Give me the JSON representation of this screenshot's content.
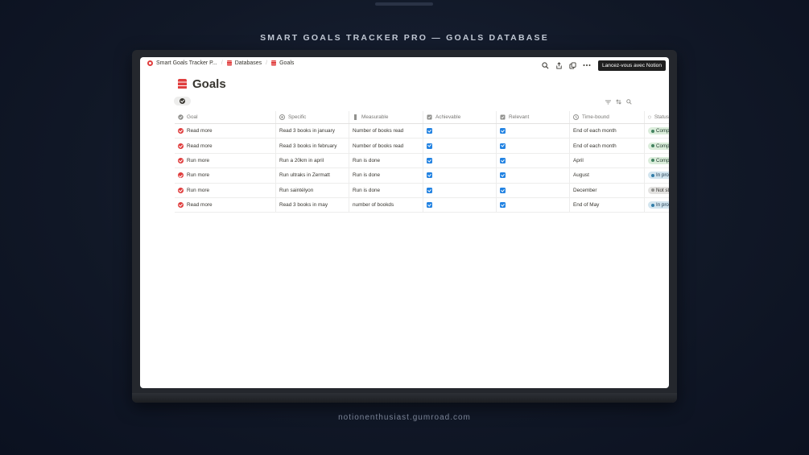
{
  "page_heading": "SMART GOALS TRACKER PRO — GOALS DATABASE",
  "footer_url": "notionenthusiast.gumroad.com",
  "breadcrumbs": [
    "Smart Goals Tracker P...",
    "Databases",
    "Goals"
  ],
  "topbar": {
    "icons": [
      "search-icon",
      "share-icon",
      "duplicate-icon",
      "more-icon"
    ],
    "cta_label": "Lancez-vous avec Notion"
  },
  "database": {
    "title": "Goals",
    "view_tools": [
      "filter-icon",
      "sort-icon",
      "search-icon"
    ]
  },
  "table": {
    "columns": [
      "Goal",
      "Specific",
      "Measurable",
      "Achievable",
      "Relevant",
      "Time-bound",
      "Status"
    ],
    "rows": [
      {
        "goal": "Read more",
        "specific": "Read 3 books in january",
        "measurable": "Number of books read",
        "achievable": true,
        "relevant": true,
        "time_bound": "End of each month",
        "status": "Comp",
        "status_type": "done"
      },
      {
        "goal": "Read more",
        "specific": "Read 3 books in february",
        "measurable": "Number of books read",
        "achievable": true,
        "relevant": true,
        "time_bound": "End of each month",
        "status": "Comp",
        "status_type": "done"
      },
      {
        "goal": "Run more",
        "specific": "Run a 20km in april",
        "measurable": "Run is done",
        "achievable": true,
        "relevant": true,
        "time_bound": "April",
        "status": "Comp",
        "status_type": "done"
      },
      {
        "goal": "Run more",
        "specific": "Run ultraks in Zermatt",
        "measurable": "Run is done",
        "achievable": true,
        "relevant": true,
        "time_bound": "August",
        "status": "In prog",
        "status_type": "progress"
      },
      {
        "goal": "Run more",
        "specific": "Run saintélyon",
        "measurable": "Run is done",
        "achievable": true,
        "relevant": true,
        "time_bound": "December",
        "status": "Not st",
        "status_type": "not-started"
      },
      {
        "goal": "Read more",
        "specific": "Read 3 books in may",
        "measurable": "number of bookds",
        "achievable": true,
        "relevant": true,
        "time_bound": "End of May",
        "status": "In prog",
        "status_type": "progress"
      }
    ]
  },
  "colors": {
    "accent_blue": "#2383e2",
    "icon_red": "#e03e3e",
    "status_done": "#dbeddb",
    "status_progress": "#d3e5ef",
    "status_not_started": "#e3e2e0"
  }
}
